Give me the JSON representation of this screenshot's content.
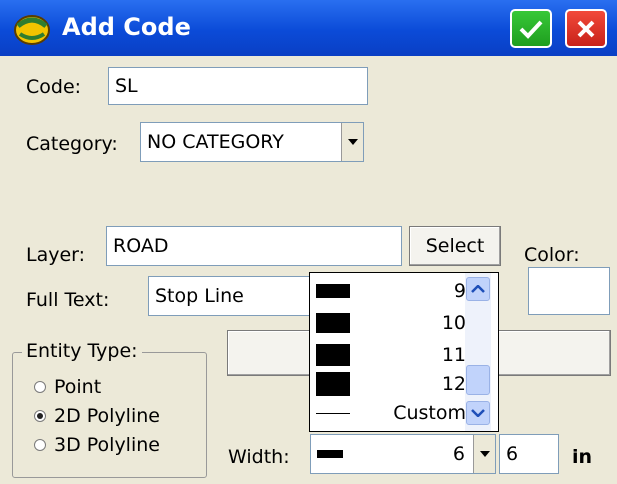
{
  "window": {
    "title": "Add Code",
    "ok_icon": "checkmark-icon",
    "close_icon": "x-icon"
  },
  "form": {
    "code_label": "Code:",
    "code_value": "SL",
    "category_label": "Category:",
    "category_value": "NO CATEGORY",
    "layer_label": "Layer:",
    "layer_value": "ROAD",
    "select_button": "Select",
    "color_label": "Color:",
    "fulltext_label": "Full Text:",
    "fulltext_value": "Stop Line",
    "entity_type_label": "Entity Type:",
    "entity_options": [
      {
        "label": "Point",
        "selected": false
      },
      {
        "label": "2D Polyline",
        "selected": true
      },
      {
        "label": "3D Polyline",
        "selected": false
      }
    ],
    "width_label": "Width:",
    "width_selected": "6",
    "width_value": "6",
    "width_unit": "in"
  },
  "width_list": {
    "items": [
      {
        "label": "9"
      },
      {
        "label": "10"
      },
      {
        "label": "11"
      },
      {
        "label": "12"
      },
      {
        "label": "Custom"
      }
    ]
  },
  "colors": {
    "titlebar": "#0b4bd8",
    "ok": "#1f9e1f",
    "close": "#c8221a",
    "window_bg": "#ece9d8"
  }
}
